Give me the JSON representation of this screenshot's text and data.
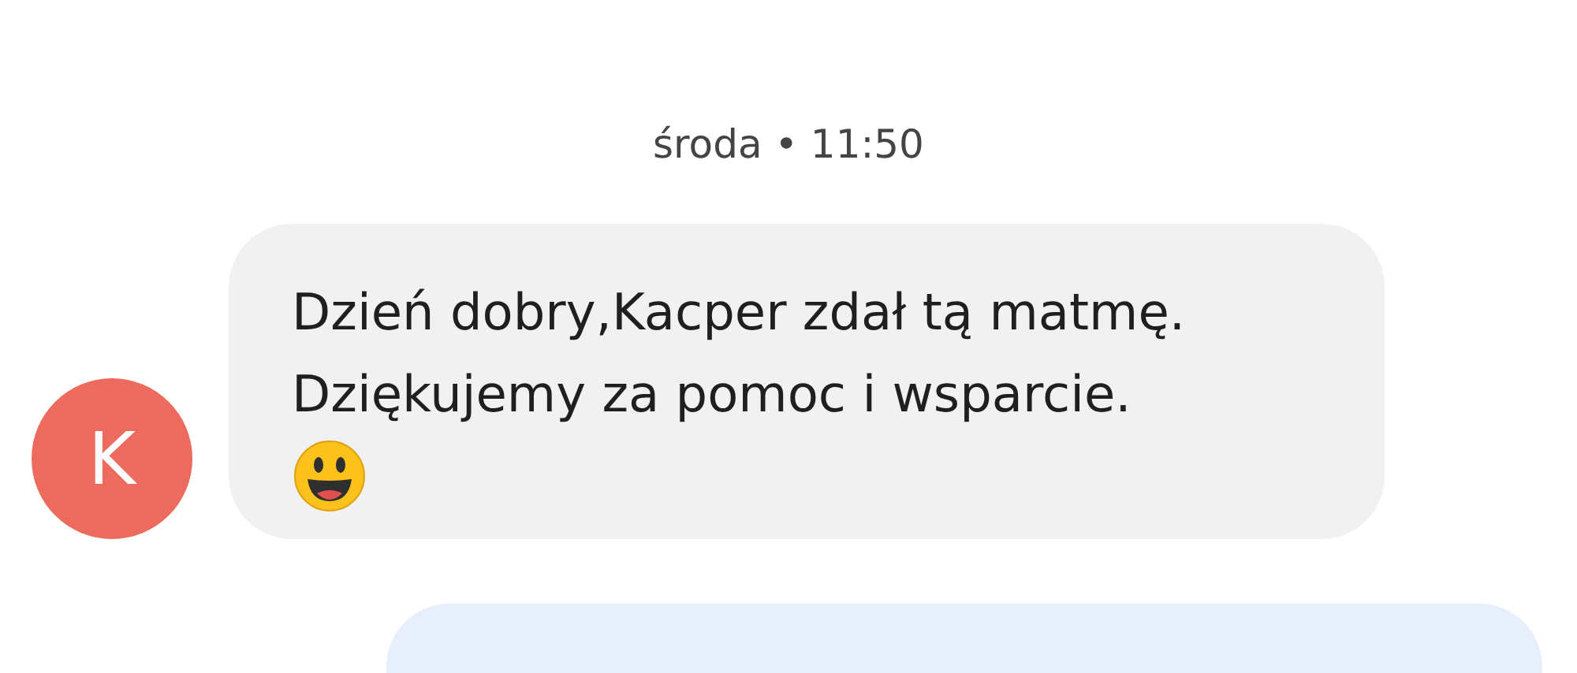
{
  "timestamp": "środa • 11:50",
  "messages": [
    {
      "kind": "incoming",
      "avatar": {
        "letter": "K",
        "color": "#ec6a5e"
      },
      "lines": [
        "Dzień dobry,Kacper zdał tą matmę.",
        "Dziękujemy za pomoc i wsparcie."
      ],
      "smiley": true
    },
    {
      "kind": "outgoing"
    }
  ]
}
